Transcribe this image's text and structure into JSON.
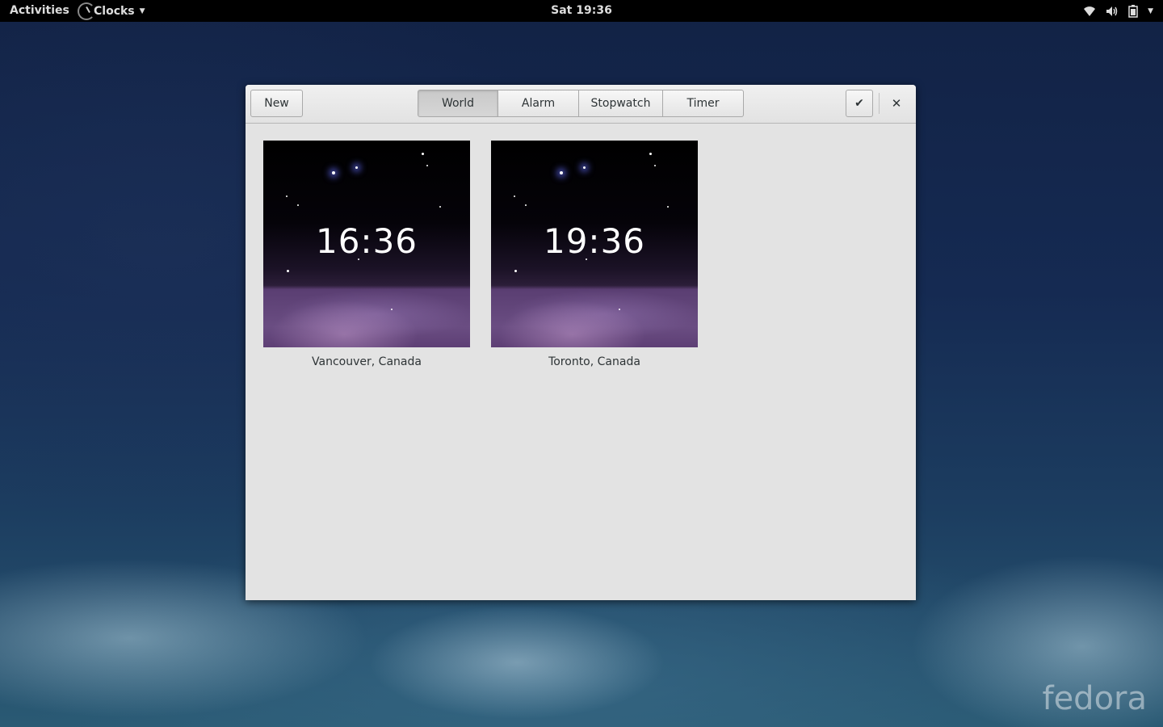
{
  "topbar": {
    "activities": "Activities",
    "app_menu": "Clocks",
    "datetime": "Sat 19:36",
    "icons": [
      "wifi-icon",
      "volume-icon",
      "battery-icon",
      "chevron-down-icon"
    ]
  },
  "window": {
    "header": {
      "new_label": "New",
      "tabs": [
        {
          "label": "World",
          "active": true
        },
        {
          "label": "Alarm",
          "active": false
        },
        {
          "label": "Stopwatch",
          "active": false
        },
        {
          "label": "Timer",
          "active": false
        }
      ]
    },
    "clocks": [
      {
        "time": "16:36",
        "city": "Vancouver, Canada"
      },
      {
        "time": "19:36",
        "city": "Toronto, Canada"
      }
    ]
  },
  "desktop": {
    "logo": "fedora"
  }
}
